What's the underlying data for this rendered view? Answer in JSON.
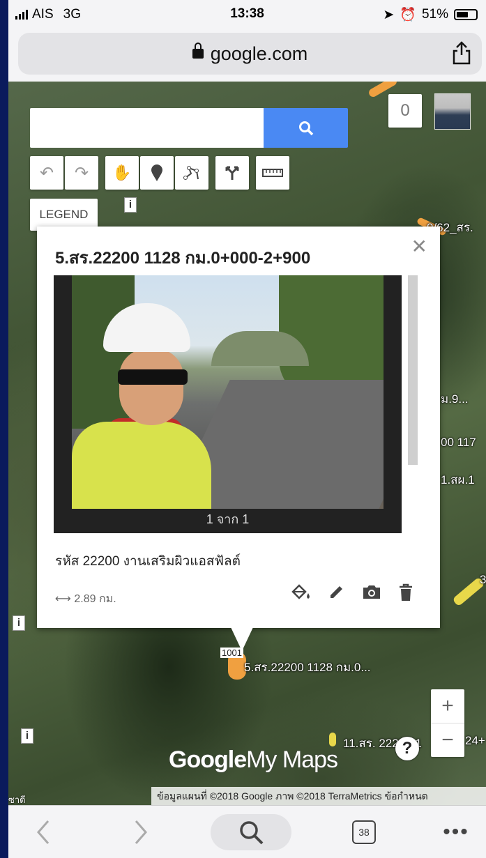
{
  "status": {
    "carrier": "AIS",
    "network": "3G",
    "time": "13:38",
    "battery_pct": "51%"
  },
  "browser": {
    "url": "google.com",
    "tabs_count": "38"
  },
  "map": {
    "counter": "0",
    "legend_label": "LEGEND",
    "search_placeholder": "",
    "labels": {
      "top_right": "9/62_สร.",
      "mid_right_1": "ม.9...",
      "mid_right_2": "00 117",
      "mid_right_3": "1.สผ.1",
      "right_3": "3",
      "marker_label": "5.สร.22200 1128 กม.0...",
      "road_number": "1001",
      "bottom_label": "11.สร. 22200 1",
      "bottom_right": "24+",
      "corner_place": "ซาดี"
    },
    "attribution": "ข้อมูลแผนที่ ©2018 Google ภาพ ©2018 TerraMetrics   ข้อกำหนด",
    "brand": {
      "google": "Google",
      "mymaps": "My Maps"
    }
  },
  "popup": {
    "title": "5.สร.22200  1128  กม.0+000-2+900",
    "photo_caption": "1 จาก 1",
    "description": "รหัส 22200  งานเสริมผิวแอสฟัลต์",
    "distance": "2.89 กม."
  },
  "colors": {
    "accent": "#4a89f3",
    "route_orange": "#f0a040",
    "route_yellow": "#e8d84a"
  }
}
